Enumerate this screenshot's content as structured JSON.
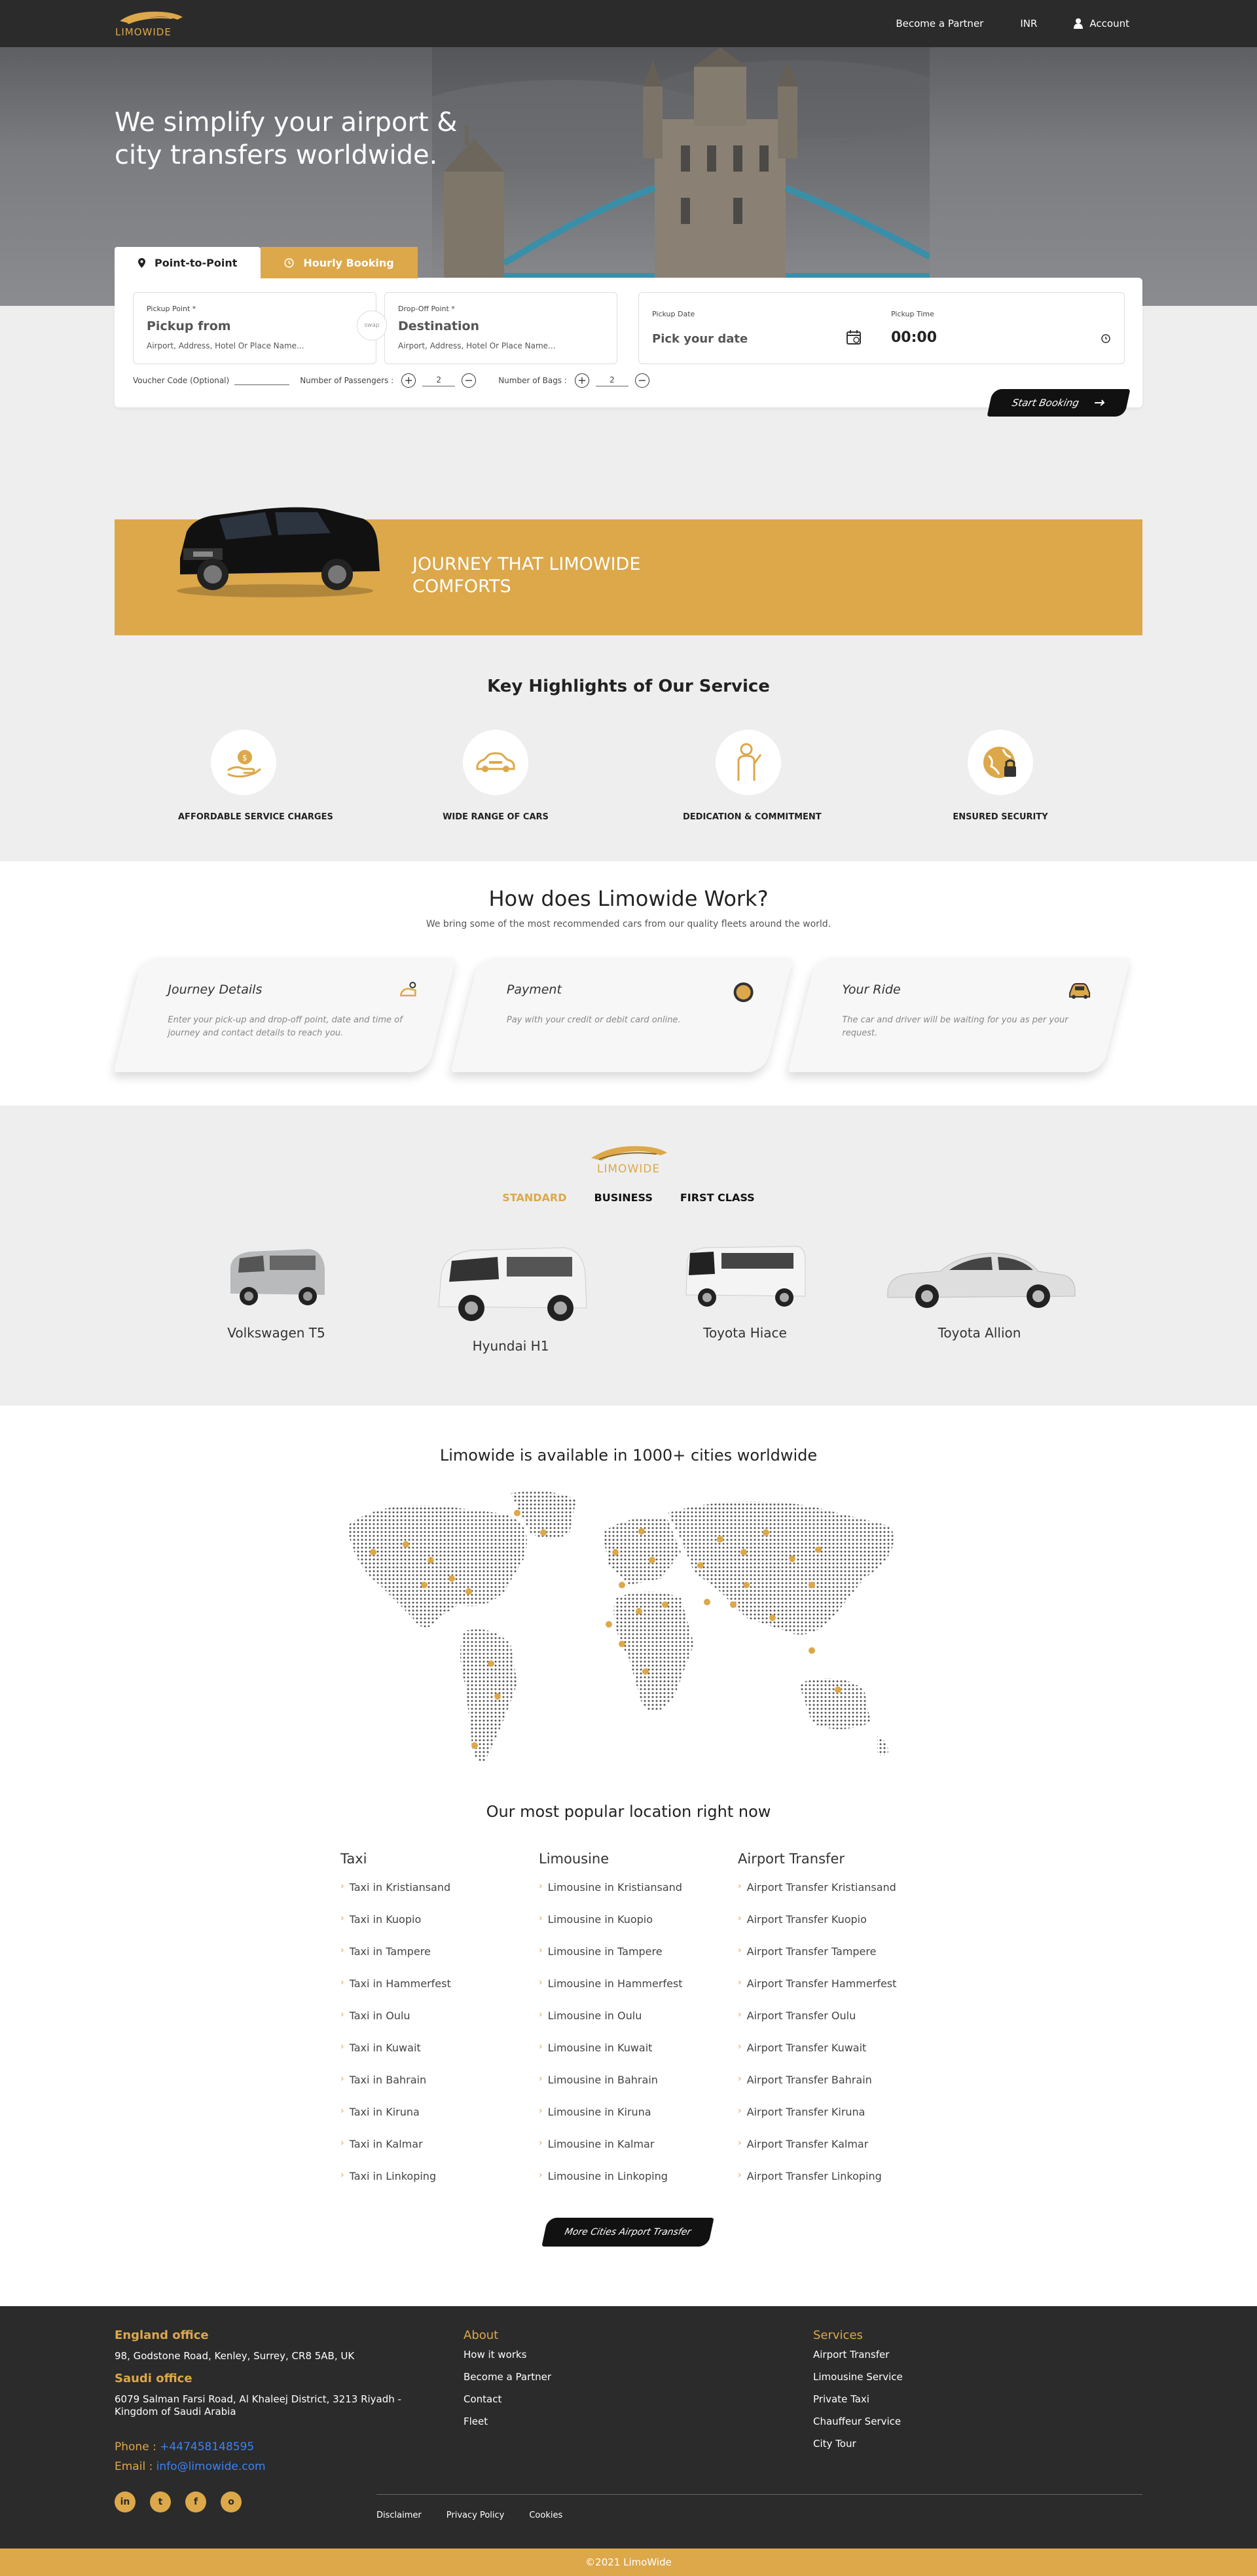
{
  "header": {
    "logo_text": "LIMOWIDE",
    "become_partner": "Become a Partner",
    "currency": "INR",
    "account": "Account"
  },
  "hero": {
    "title": "We simplify your airport & city transfers worldwide."
  },
  "booking": {
    "tab_point": "Point-to-Point",
    "tab_hourly": "Hourly Booking",
    "pickup_label": "Pickup Point *",
    "pickup_value": "Pickup from",
    "pickup_hint": "Airport, Address, Hotel Or Place Name...",
    "dropoff_label": "Drop-Off Point *",
    "dropoff_value": "Destination",
    "dropoff_hint": "Airport, Address, Hotel Or Place Name...",
    "swap_text": "swap",
    "date_label": "Pickup Date",
    "date_value": "Pick your date",
    "time_label": "Pickup Time",
    "time_value": "00:00",
    "voucher_label": "Voucher Code (Optional)",
    "passengers_label": "Number of Passengers :",
    "passengers_value": "2",
    "bags_label": "Number of Bags :",
    "bags_value": "2",
    "start_button": "Start Booking"
  },
  "journey": {
    "text": "JOURNEY THAT LIMOWIDE COMFORTS"
  },
  "highlights": {
    "title": "Key Highlights of Our Service",
    "items": [
      {
        "label": "AFFORDABLE SERVICE CHARGES",
        "icon": "hand-coin-icon"
      },
      {
        "label": "WIDE RANGE OF CARS",
        "icon": "car-icon"
      },
      {
        "label": "DEDICATION & COMMITMENT",
        "icon": "chauffeur-icon"
      },
      {
        "label": "ENSURED SECURITY",
        "icon": "globe-lock-icon"
      }
    ]
  },
  "how": {
    "title": "How does Limowide Work?",
    "subtitle": "We bring some of the most recommended cars from our quality fleets around the world.",
    "steps": [
      {
        "title": "Journey Details",
        "desc": "Enter your pick-up and drop-off point, date and time of journey and contact details to reach you."
      },
      {
        "title": "Payment",
        "desc": "Pay with your credit or debit card online."
      },
      {
        "title": "Your Ride",
        "desc": "The car and driver will be waiting for you as per your request."
      }
    ]
  },
  "fleet": {
    "logo_text": "LIMOWIDE",
    "tabs": [
      "STANDARD",
      "BUSINESS",
      "FIRST CLASS"
    ],
    "active_tab": "STANDARD",
    "cars": [
      "Volkswagen T5",
      "Hyundai H1",
      "Toyota Hiace",
      "Toyota Allion"
    ]
  },
  "map": {
    "title": "Limowide is available in 1000+ cities worldwide"
  },
  "popular": {
    "title": "Our most popular location right now",
    "columns": [
      {
        "heading": "Taxi",
        "items": [
          "Taxi in Kristiansand",
          "Taxi in Kuopio",
          "Taxi in Tampere",
          "Taxi in Hammerfest",
          "Taxi in Oulu",
          "Taxi in Kuwait",
          "Taxi in Bahrain",
          "Taxi in Kiruna",
          "Taxi in Kalmar",
          "Taxi in Linkoping"
        ]
      },
      {
        "heading": "Limousine",
        "items": [
          "Limousine in Kristiansand",
          "Limousine in Kuopio",
          "Limousine in Tampere",
          "Limousine in Hammerfest",
          "Limousine in Oulu",
          "Limousine in Kuwait",
          "Limousine in Bahrain",
          "Limousine in Kiruna",
          "Limousine in Kalmar",
          "Limousine in Linkoping"
        ]
      },
      {
        "heading": "Airport Transfer",
        "items": [
          "Airport Transfer Kristiansand",
          "Airport Transfer Kuopio",
          "Airport Transfer Tampere",
          "Airport Transfer Hammerfest",
          "Airport Transfer Oulu",
          "Airport Transfer Kuwait",
          "Airport Transfer Bahrain",
          "Airport Transfer Kiruna",
          "Airport Transfer Kalmar",
          "Airport Transfer Linkoping"
        ]
      }
    ],
    "more_button": "More Cities Airport Transfer"
  },
  "footer": {
    "england_title": "England office",
    "england_address": "98, Godstone Road, Kenley, Surrey, CR8 5AB, UK",
    "saudi_title": "Saudi office",
    "saudi_address": "6079 Salman Farsi Road, Al Khaleej District, 3213 Riyadh - Kingdom of Saudi Arabia",
    "phone_label": "Phone : ",
    "phone": "+447458148595",
    "email_label": "Email : ",
    "email": "info@limowide.com",
    "about_title": "About",
    "about_links": [
      "How it works",
      "Become a Partner",
      "Contact",
      "Fleet"
    ],
    "services_title": "Services",
    "services_links": [
      "Airport Transfer",
      "Limousine Service",
      "Private Taxi",
      "Chauffeur Service",
      "City Tour"
    ],
    "legal": [
      "Disclaimer",
      "Privacy Policy",
      "Cookies"
    ],
    "social": [
      "in",
      "t",
      "f",
      "o"
    ],
    "copyright": "©2021 LimoWide"
  },
  "colors": {
    "accent": "#dca84a",
    "dark": "#2b2b2b",
    "light_bg": "#eeeeee"
  }
}
